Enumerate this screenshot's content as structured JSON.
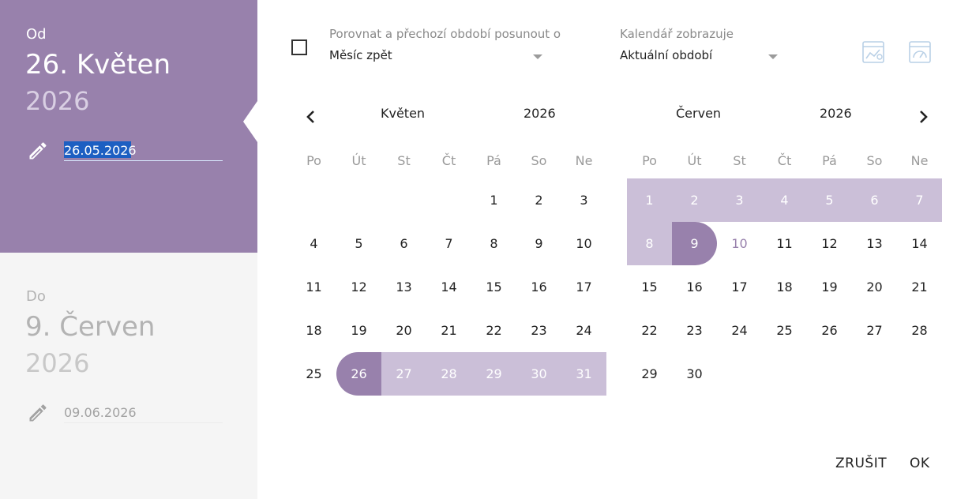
{
  "from": {
    "label": "Od",
    "date_big": "26. Květen",
    "year": "2026",
    "input_value": "26.05.2026"
  },
  "to": {
    "label": "Do",
    "date_big": "9. Červen",
    "year": "2026",
    "input_value": "09.06.2026"
  },
  "compare": {
    "label": "Porovnat a přechozí období posunout o",
    "value": "Měsíc zpět"
  },
  "calendar_view": {
    "label": "Kalendář zobrazuje",
    "value": "Aktuální období"
  },
  "weekdays": [
    "Po",
    "Út",
    "St",
    "Čt",
    "Pá",
    "So",
    "Ne"
  ],
  "months": [
    {
      "name": "Květen",
      "year": "2026",
      "first_weekday": 4,
      "days": 31,
      "range_from": 26,
      "range_to": 31,
      "selected": 26,
      "today": null
    },
    {
      "name": "Červen",
      "year": "2026",
      "first_weekday": 0,
      "days": 30,
      "range_from": 1,
      "range_to": 9,
      "selected": 9,
      "today": 10
    }
  ],
  "colors": {
    "accent": "#9881ac",
    "range": "#cbbfd8",
    "to_panel": "#f5f5f5"
  },
  "icons": {
    "prev": "chevron-left-icon",
    "next": "chevron-right-icon",
    "edit": "pencil-icon",
    "tool1": "chart-window-icon",
    "tool2": "gauge-window-icon"
  },
  "actions": {
    "cancel": "ZRUŠIT",
    "ok": "OK"
  }
}
